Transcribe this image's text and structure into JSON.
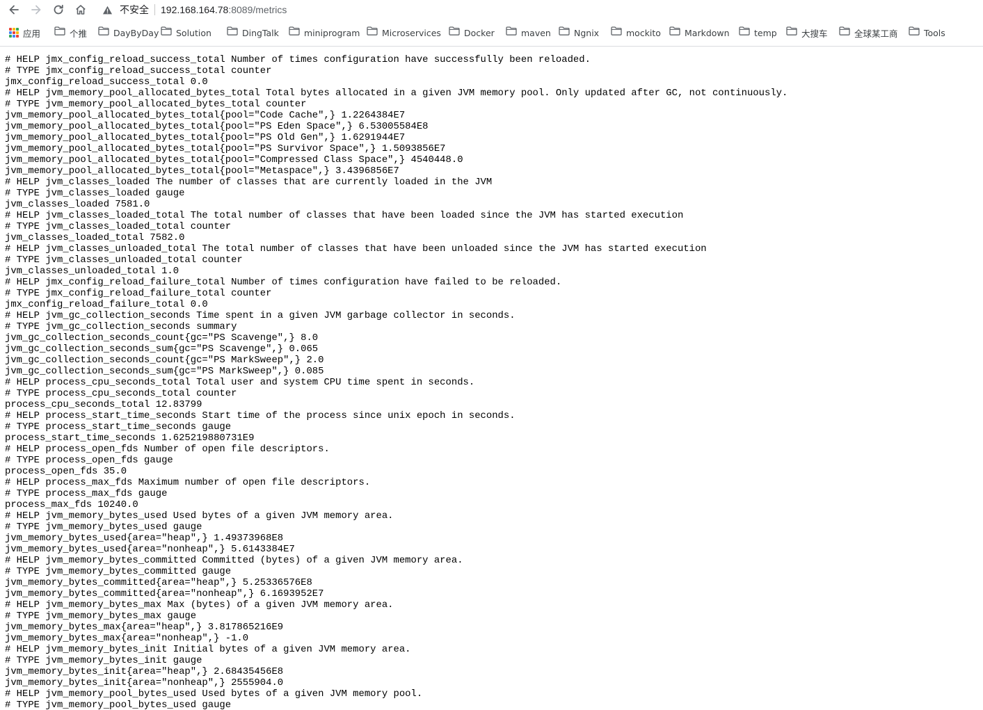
{
  "toolbar": {
    "insecure_label": "不安全",
    "url_host": "192.168.164.78",
    "url_rest": ":8089/metrics"
  },
  "bookmarks": [
    {
      "label": "应用",
      "icon": "apps-grid-icon"
    },
    {
      "label": "个推",
      "icon": "folder-icon"
    },
    {
      "label": "DayByDay",
      "icon": "folder-icon"
    },
    {
      "label": "Solution",
      "icon": "folder-icon"
    },
    {
      "label": "DingTalk",
      "icon": "folder-icon"
    },
    {
      "label": "miniprogram",
      "icon": "folder-icon"
    },
    {
      "label": "Microservices",
      "icon": "folder-icon"
    },
    {
      "label": "Docker",
      "icon": "folder-icon"
    },
    {
      "label": "maven",
      "icon": "folder-icon"
    },
    {
      "label": "Ngnix",
      "icon": "folder-icon"
    },
    {
      "label": "mockito",
      "icon": "folder-icon"
    },
    {
      "label": "Markdown",
      "icon": "folder-icon"
    },
    {
      "label": "temp",
      "icon": "folder-icon"
    },
    {
      "label": "大搜车",
      "icon": "folder-icon"
    },
    {
      "label": "全球某工商",
      "icon": "folder-icon"
    },
    {
      "label": "Tools",
      "icon": "folder-icon"
    }
  ],
  "lines": [
    "# HELP jmx_config_reload_success_total Number of times configuration have successfully been reloaded.",
    "# TYPE jmx_config_reload_success_total counter",
    "jmx_config_reload_success_total 0.0",
    "# HELP jvm_memory_pool_allocated_bytes_total Total bytes allocated in a given JVM memory pool. Only updated after GC, not continuously.",
    "# TYPE jvm_memory_pool_allocated_bytes_total counter",
    "jvm_memory_pool_allocated_bytes_total{pool=\"Code Cache\",} 1.2264384E7",
    "jvm_memory_pool_allocated_bytes_total{pool=\"PS Eden Space\",} 6.53005584E8",
    "jvm_memory_pool_allocated_bytes_total{pool=\"PS Old Gen\",} 1.6291944E7",
    "jvm_memory_pool_allocated_bytes_total{pool=\"PS Survivor Space\",} 1.5093856E7",
    "jvm_memory_pool_allocated_bytes_total{pool=\"Compressed Class Space\",} 4540448.0",
    "jvm_memory_pool_allocated_bytes_total{pool=\"Metaspace\",} 3.4396856E7",
    "# HELP jvm_classes_loaded The number of classes that are currently loaded in the JVM",
    "# TYPE jvm_classes_loaded gauge",
    "jvm_classes_loaded 7581.0",
    "# HELP jvm_classes_loaded_total The total number of classes that have been loaded since the JVM has started execution",
    "# TYPE jvm_classes_loaded_total counter",
    "jvm_classes_loaded_total 7582.0",
    "# HELP jvm_classes_unloaded_total The total number of classes that have been unloaded since the JVM has started execution",
    "# TYPE jvm_classes_unloaded_total counter",
    "jvm_classes_unloaded_total 1.0",
    "# HELP jmx_config_reload_failure_total Number of times configuration have failed to be reloaded.",
    "# TYPE jmx_config_reload_failure_total counter",
    "jmx_config_reload_failure_total 0.0",
    "# HELP jvm_gc_collection_seconds Time spent in a given JVM garbage collector in seconds.",
    "# TYPE jvm_gc_collection_seconds summary",
    "jvm_gc_collection_seconds_count{gc=\"PS Scavenge\",} 8.0",
    "jvm_gc_collection_seconds_sum{gc=\"PS Scavenge\",} 0.065",
    "jvm_gc_collection_seconds_count{gc=\"PS MarkSweep\",} 2.0",
    "jvm_gc_collection_seconds_sum{gc=\"PS MarkSweep\",} 0.085",
    "# HELP process_cpu_seconds_total Total user and system CPU time spent in seconds.",
    "# TYPE process_cpu_seconds_total counter",
    "process_cpu_seconds_total 12.83799",
    "# HELP process_start_time_seconds Start time of the process since unix epoch in seconds.",
    "# TYPE process_start_time_seconds gauge",
    "process_start_time_seconds 1.625219880731E9",
    "# HELP process_open_fds Number of open file descriptors.",
    "# TYPE process_open_fds gauge",
    "process_open_fds 35.0",
    "# HELP process_max_fds Maximum number of open file descriptors.",
    "# TYPE process_max_fds gauge",
    "process_max_fds 10240.0",
    "# HELP jvm_memory_bytes_used Used bytes of a given JVM memory area.",
    "# TYPE jvm_memory_bytes_used gauge",
    "jvm_memory_bytes_used{area=\"heap\",} 1.49373968E8",
    "jvm_memory_bytes_used{area=\"nonheap\",} 5.6143384E7",
    "# HELP jvm_memory_bytes_committed Committed (bytes) of a given JVM memory area.",
    "# TYPE jvm_memory_bytes_committed gauge",
    "jvm_memory_bytes_committed{area=\"heap\",} 5.25336576E8",
    "jvm_memory_bytes_committed{area=\"nonheap\",} 6.1693952E7",
    "# HELP jvm_memory_bytes_max Max (bytes) of a given JVM memory area.",
    "# TYPE jvm_memory_bytes_max gauge",
    "jvm_memory_bytes_max{area=\"heap\",} 3.817865216E9",
    "jvm_memory_bytes_max{area=\"nonheap\",} -1.0",
    "# HELP jvm_memory_bytes_init Initial bytes of a given JVM memory area.",
    "# TYPE jvm_memory_bytes_init gauge",
    "jvm_memory_bytes_init{area=\"heap\",} 2.68435456E8",
    "jvm_memory_bytes_init{area=\"nonheap\",} 2555904.0",
    "# HELP jvm_memory_pool_bytes_used Used bytes of a given JVM memory pool.",
    "# TYPE jvm_memory_pool_bytes_used gauge"
  ]
}
